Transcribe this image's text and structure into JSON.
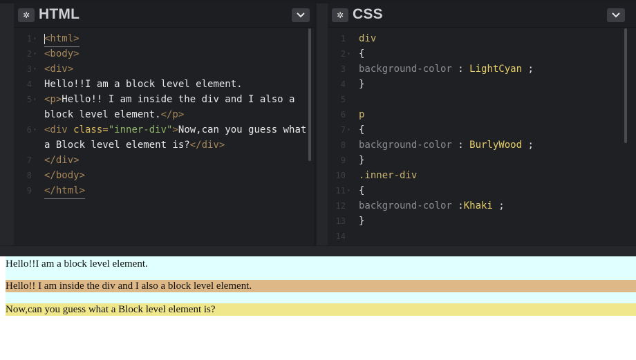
{
  "html_panel": {
    "title": "HTML",
    "lines": [
      {
        "n": "1",
        "fold": "▾"
      },
      {
        "n": "2",
        "fold": "▾"
      },
      {
        "n": "3",
        "fold": "▾"
      },
      {
        "n": "4",
        "fold": ""
      },
      {
        "n": "5",
        "fold": "▾"
      },
      {
        "n": "",
        "fold": ""
      },
      {
        "n": "6",
        "fold": "▾"
      },
      {
        "n": "",
        "fold": ""
      },
      {
        "n": "7",
        "fold": ""
      },
      {
        "n": "8",
        "fold": ""
      },
      {
        "n": "9",
        "fold": ""
      }
    ],
    "code": {
      "l1": "<html>",
      "l2": "<body>",
      "l3": "<div>",
      "l4": "Hello!!I am a block level element.",
      "l5_open": "<p>",
      "l5_text": "Hello!! I am inside the div and I also a",
      "l5b_text": "block level element.",
      "l5b_close": "</p>",
      "l6_open": "<div",
      "l6_attr": " class=",
      "l6_str": "\"inner-div\"",
      "l6_gt": ">",
      "l6_text": "Now,can you guess what",
      "l6b_text": "a Block level element is?",
      "l6b_close": "</div>",
      "l7": "</div>",
      "l8": "</body>",
      "l9": "</html>"
    }
  },
  "css_panel": {
    "title": "CSS",
    "lines": [
      {
        "n": "1",
        "fold": ""
      },
      {
        "n": "2",
        "fold": "▾"
      },
      {
        "n": "3",
        "fold": ""
      },
      {
        "n": "4",
        "fold": ""
      },
      {
        "n": "5",
        "fold": ""
      },
      {
        "n": "6",
        "fold": ""
      },
      {
        "n": "7",
        "fold": "▾"
      },
      {
        "n": "8",
        "fold": ""
      },
      {
        "n": "9",
        "fold": ""
      },
      {
        "n": "10",
        "fold": ""
      },
      {
        "n": "11",
        "fold": "▾"
      },
      {
        "n": "12",
        "fold": ""
      },
      {
        "n": "13",
        "fold": ""
      },
      {
        "n": "14",
        "fold": ""
      }
    ],
    "code": {
      "l1": "div",
      "l2": "{",
      "l3_prop": "background-color",
      "l3_sep": " : ",
      "l3_val": "LightCyan",
      "l3_end": "  ;",
      "l4": "}",
      "l6": "p",
      "l7": "{",
      "l8_prop": "background-color",
      "l8_sep": " : ",
      "l8_val": "BurlyWood",
      "l8_end": " ;",
      "l9": "}",
      "l10": ".inner-div",
      "l11": "{",
      "l12_prop": "background-color",
      "l12_sep": " :",
      "l12_val": "Khaki",
      "l12_end": " ;",
      "l13": "}"
    }
  },
  "preview": {
    "div_text": "Hello!!I am a block level element.",
    "p_text": "Hello!! I am inside the div and I also a block level element.",
    "inner_text": "Now,can you guess what a Block level element is?"
  },
  "colors": {
    "lightcyan": "#e0ffff",
    "burlywood": "#deb887",
    "khaki": "#f0e68c"
  }
}
